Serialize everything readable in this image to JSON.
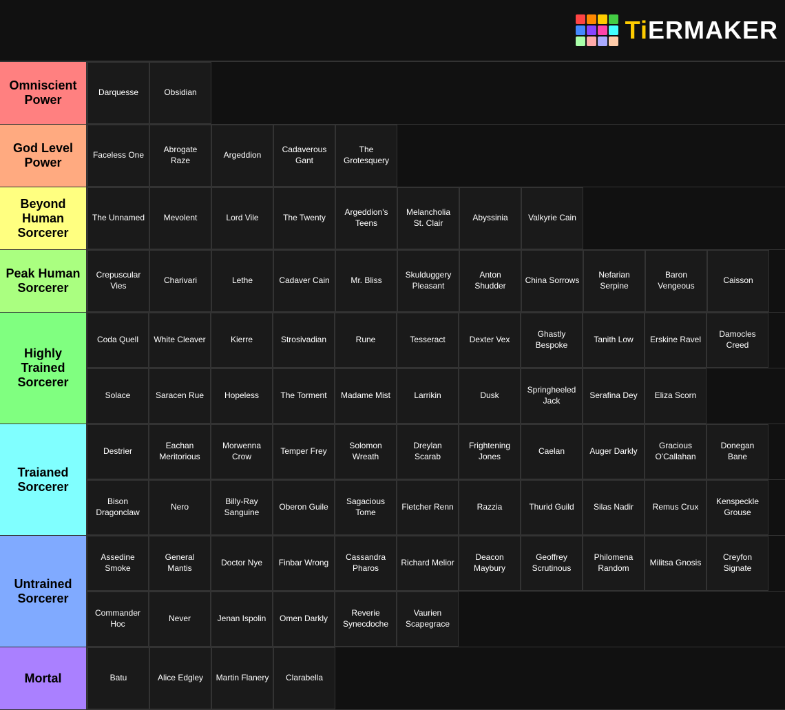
{
  "logo": {
    "text": "TiERMAKER",
    "colors": [
      "#ff4444",
      "#ff8800",
      "#ffcc00",
      "#44cc44",
      "#4488ff",
      "#8844ff",
      "#ff44aa",
      "#44ffff",
      "#aaffaa",
      "#ffaaaa",
      "#aaaaff",
      "#ffccaa"
    ]
  },
  "tiers": [
    {
      "id": "omniscient",
      "label": "Omniscient Power",
      "color": "#ff8080",
      "textColor": "#000",
      "cells": [
        "Darquesse",
        "Obsidian"
      ]
    },
    {
      "id": "godlevel",
      "label": "God Level Power",
      "color": "#ffaa80",
      "textColor": "#000",
      "cells": [
        "Faceless One",
        "Abrogate Raze",
        "Argeddion",
        "Cadaverous Gant",
        "The Grotesquery"
      ]
    },
    {
      "id": "beyondhuman",
      "label": "Beyond Human Sorcerer",
      "color": "#ffff80",
      "textColor": "#000",
      "cells": [
        "The Unnamed",
        "Mevolent",
        "Lord Vile",
        "The Twenty",
        "Argeddion's Teens",
        "Melancholia St. Clair",
        "Abyssinia",
        "Valkyrie Cain"
      ]
    },
    {
      "id": "peakhuman",
      "label": "Peak Human Sorcerer",
      "color": "#aaff80",
      "textColor": "#000",
      "cells": [
        "Crepuscular Vies",
        "Charivari",
        "Lethe",
        "Cadaver Cain",
        "Mr. Bliss",
        "Skulduggery Pleasant",
        "Anton Shudder",
        "China Sorrows",
        "Nefarian Serpine",
        "Baron Vengeous",
        "Caisson"
      ]
    },
    {
      "id": "highlytrained1",
      "label": "Highly Trained Sorcerer",
      "color": "#80ff80",
      "textColor": "#000",
      "rowSpan": 2,
      "cells": [
        "Coda Quell",
        "White Cleaver",
        "Kierre",
        "Strosivadian",
        "Rune",
        "Tesseract",
        "Dexter Vex",
        "Ghastly Bespoke",
        "Tanith Low",
        "Erskine Ravel",
        "Damocles Creed"
      ]
    },
    {
      "id": "highlytrained2",
      "label": "",
      "color": "#80ff80",
      "textColor": "#000",
      "cells": [
        "Solace",
        "Saracen Rue",
        "Hopeless",
        "The Torment",
        "Madame Mist",
        "Larrikin",
        "Dusk",
        "Springheeled Jack",
        "Serafina Dey",
        "Eliza Scorn"
      ]
    },
    {
      "id": "trained1",
      "label": "Traianed Sorcerer",
      "color": "#80ffff",
      "textColor": "#000",
      "rowSpan": 2,
      "cells": [
        "Destrier",
        "Eachan Meritorious",
        "Morwenna Crow",
        "Temper Frey",
        "Solomon Wreath",
        "Dreylan Scarab",
        "Frightening Jones",
        "Caelan",
        "Auger Darkly",
        "Gracious O'Callahan",
        "Donegan Bane"
      ]
    },
    {
      "id": "trained2",
      "label": "",
      "color": "#80ffff",
      "textColor": "#000",
      "cells": [
        "Bison Dragonclaw",
        "Nero",
        "Billy-Ray Sanguine",
        "Oberon Guile",
        "Sagacious Tome",
        "Fletcher Renn",
        "Razzia",
        "Thurid Guild",
        "Silas Nadir",
        "Remus Crux",
        "Kenspeckle Grouse"
      ]
    },
    {
      "id": "untrained1",
      "label": "Untrained Sorcerer",
      "color": "#80aaff",
      "textColor": "#000",
      "rowSpan": 2,
      "cells": [
        "Assedine Smoke",
        "General Mantis",
        "Doctor Nye",
        "Finbar Wrong",
        "Cassandra Pharos",
        "Richard Melior",
        "Deacon Maybury",
        "Geoffrey Scrutinous",
        "Philomena Random",
        "Militsa Gnosis",
        "Creyfon Signate"
      ]
    },
    {
      "id": "untrained2",
      "label": "",
      "color": "#80aaff",
      "textColor": "#000",
      "cells": [
        "Commander Hoc",
        "Never",
        "Jenan Ispolin",
        "Omen Darkly",
        "Reverie Synecdoche",
        "Vaurien Scapegrace"
      ]
    },
    {
      "id": "mortal",
      "label": "Mortal",
      "color": "#aa80ff",
      "textColor": "#000",
      "cells": [
        "Batu",
        "Alice Edgley",
        "Martin Flanery",
        "Clarabella"
      ]
    }
  ]
}
